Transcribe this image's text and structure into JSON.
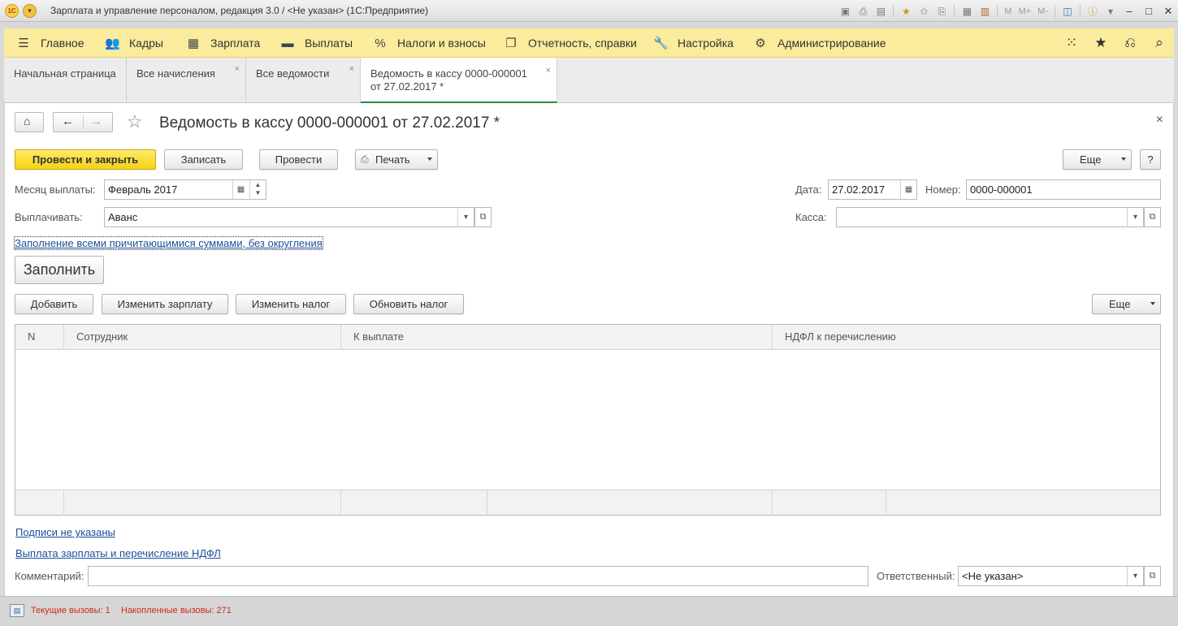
{
  "window": {
    "title": "Зарплата и управление персоналом, редакция 3.0 / <Не указан>  (1С:Предприятие)",
    "m_labels": [
      "M",
      "M+",
      "M-"
    ]
  },
  "sections": [
    {
      "label": "Главное",
      "icon": "menu-icon"
    },
    {
      "label": "Кадры",
      "icon": "people-icon"
    },
    {
      "label": "Зарплата",
      "icon": "calculator-icon"
    },
    {
      "label": "Выплаты",
      "icon": "money-icon"
    },
    {
      "label": "Налоги и взносы",
      "icon": "percent-icon"
    },
    {
      "label": "Отчетность, справки",
      "icon": "reports-icon"
    },
    {
      "label": "Настройка",
      "icon": "wrench-icon"
    },
    {
      "label": "Администрирование",
      "icon": "gear-icon"
    }
  ],
  "tabs": [
    {
      "label": "Начальная страница"
    },
    {
      "label": "Все начисления"
    },
    {
      "label": "Все ведомости"
    },
    {
      "label_line1": "Ведомость в кассу 0000-000001",
      "label_line2": "от 27.02.2017 *"
    }
  ],
  "document": {
    "title": "Ведомость в кассу 0000-000001 от 27.02.2017 *"
  },
  "toolbar": {
    "post_close": "Провести и закрыть",
    "save": "Записать",
    "post": "Провести",
    "print": "Печать",
    "more": "Еще",
    "help": "?"
  },
  "form": {
    "month_label": "Месяц выплаты:",
    "month_value": "Февраль 2017",
    "date_label": "Дата:",
    "date_value": "27.02.2017",
    "number_label": "Номер:",
    "number_value": "0000-000001",
    "pay_label": "Выплачивать:",
    "pay_value": "Аванс",
    "cash_label": "Касса:",
    "cash_value": "",
    "fill_mode_link": "Заполнение всеми причитающимися суммами, без округления",
    "fill_button": "Заполнить"
  },
  "table_toolbar": {
    "add": "Добавить",
    "change_salary": "Изменить зарплату",
    "change_tax": "Изменить налог",
    "update_tax": "Обновить налог",
    "more": "Еще"
  },
  "table": {
    "columns": [
      "N",
      "Сотрудник",
      "К выплате",
      "НДФЛ к перечислению"
    ],
    "rows": []
  },
  "footer": {
    "signatures_link": "Подписи не указаны",
    "payment_link": "Выплата зарплаты и перечисление НДФЛ",
    "comment_label": "Комментарий:",
    "comment_value": "",
    "responsible_label": "Ответственный:",
    "responsible_value": "<Не указан>"
  },
  "status": {
    "current_calls": "Текущие вызовы: 1",
    "accumulated_calls": "Накопленные вызовы: 271"
  },
  "colors": {
    "section_panel": "#fbeb9c",
    "primary_button": "#f5d312",
    "active_tab_underline": "#2e8b3e",
    "link": "#1d4f99",
    "status_text": "#d0281c"
  }
}
